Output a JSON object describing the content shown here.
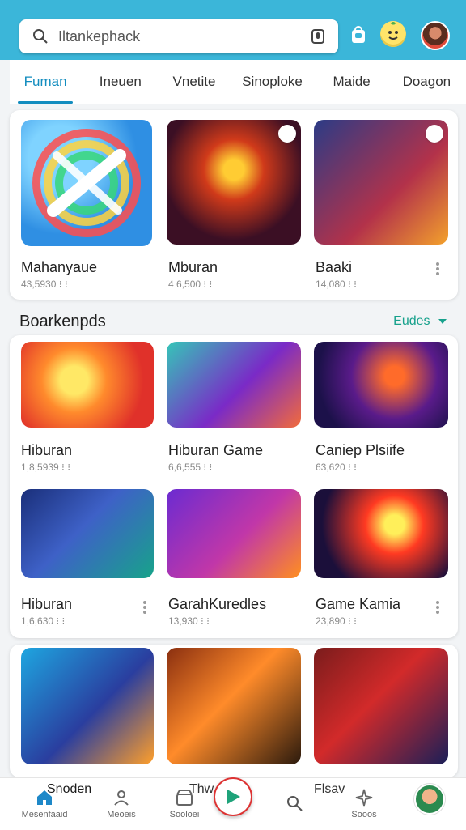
{
  "header": {
    "search_placeholder": "Iltankephack"
  },
  "tabs": [
    {
      "label": "Fuman"
    },
    {
      "label": "Ineuen"
    },
    {
      "label": "Vnetite"
    },
    {
      "label": "Sinoploke"
    },
    {
      "label": "Maide"
    },
    {
      "label": "Doagon"
    }
  ],
  "featured": [
    {
      "title": "Mahanyaue",
      "meta": "43,5930 ⁝ ⁝"
    },
    {
      "title": "Mburan",
      "meta": "4 6,500 ⁝ ⁝"
    },
    {
      "title": "Baaki",
      "meta": "14,080 ⁝ ⁝"
    }
  ],
  "section": {
    "title": "Boarkenpds",
    "link": "Eudes"
  },
  "grid": [
    {
      "title": "Hiburan",
      "meta": "1,8,5939 ⁝ ⁝"
    },
    {
      "title": "Hiburan Game",
      "meta": "6,6,555 ⁝ ⁝"
    },
    {
      "title": "Caniep Plsiife",
      "meta": "63,620 ⁝ ⁝"
    },
    {
      "title": "Hiburan",
      "meta": "1,6,630 ⁝ ⁝"
    },
    {
      "title": "GarahKuredles",
      "meta": "13,930 ⁝ ⁝"
    },
    {
      "title": "Game Kamia",
      "meta": "23,890 ⁝ ⁝"
    }
  ],
  "bottom_nav": {
    "home_top": "Snoden",
    "home": "Mesenfaaid",
    "profile": "Meoeis",
    "store": "Sooloei",
    "store_top": "Thw",
    "search_top": "Flsav",
    "spark": "Sooos"
  },
  "colors": {
    "topbar": "#3bb6d9",
    "tab_active": "#138dbf",
    "section_link": "#17a18c"
  }
}
